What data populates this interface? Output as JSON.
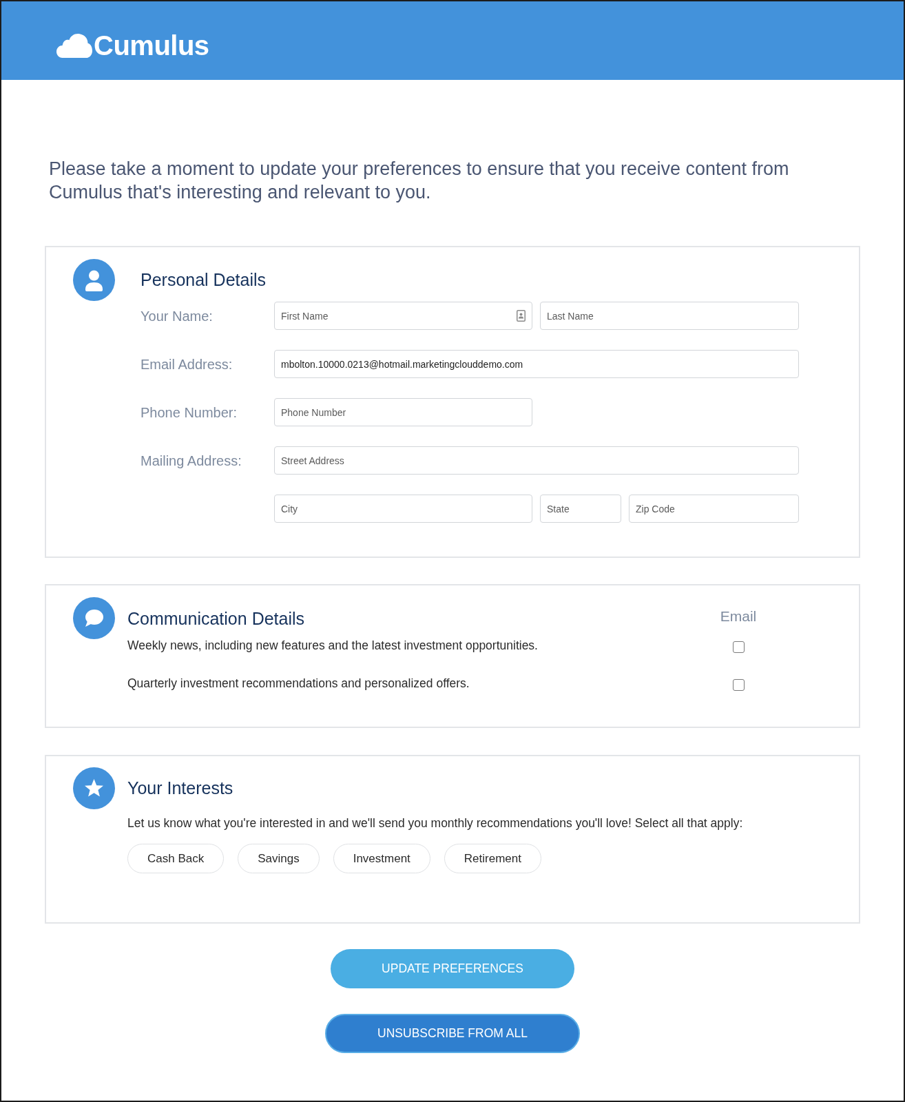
{
  "header": {
    "logo_text": "Cumulus"
  },
  "intro": "Please take a moment to update your preferences to ensure that you receive content from Cumulus that's interesting and relevant to you.",
  "personal_details": {
    "title": "Personal Details",
    "rows": [
      {
        "label": "Your Name:",
        "fields": [
          {
            "kind": "firstname",
            "placeholder": "First Name",
            "contact_icon": true
          },
          {
            "kind": "lastname",
            "placeholder": "Last Name"
          }
        ]
      },
      {
        "label": "Email Address:",
        "fields": [
          {
            "kind": "email",
            "value": "mbolton.10000.0213@hotmail.marketingclouddemo.com"
          }
        ]
      },
      {
        "label": "Phone Number:",
        "fields": [
          {
            "kind": "phone",
            "placeholder": "Phone Number"
          }
        ]
      },
      {
        "label": "Mailing Address:",
        "fields": [
          {
            "kind": "street",
            "placeholder": "Street Address"
          }
        ]
      },
      {
        "fields": [
          {
            "kind": "city",
            "placeholder": "City"
          },
          {
            "kind": "state",
            "placeholder": "State"
          },
          {
            "kind": "zip",
            "placeholder": "Zip Code"
          }
        ]
      }
    ]
  },
  "communication_details": {
    "title": "Communication Details",
    "column_heading": "Email",
    "options": [
      {
        "text": "Weekly news, including new features and the latest investment opportunities.",
        "checked": false
      },
      {
        "text": "Quarterly investment recommendations and personalized offers.",
        "checked": false
      }
    ]
  },
  "interests": {
    "title": "Your Interests",
    "description": "Let us know what you're interested in and we'll send you monthly recommendations you'll love! Select all that apply:",
    "chips": [
      {
        "label": "Cash Back",
        "selected": false
      },
      {
        "label": "Savings",
        "selected": false
      },
      {
        "label": "Investment",
        "selected": false
      },
      {
        "label": "Retirement",
        "selected": false
      }
    ]
  },
  "buttons": [
    {
      "kind": "primary",
      "label": "UPDATE PREFERENCES"
    },
    {
      "kind": "secondary",
      "label": "UNSUBSCRIBE FROM ALL"
    }
  ]
}
